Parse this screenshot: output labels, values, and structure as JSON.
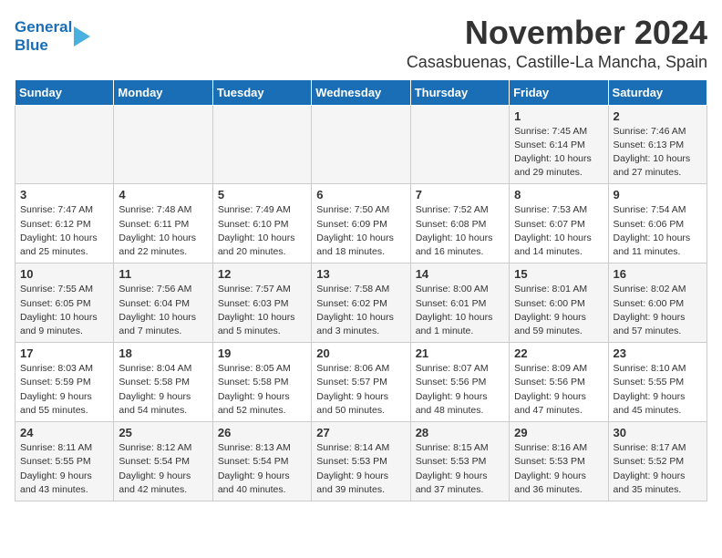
{
  "logo": {
    "line1": "General",
    "line2": "Blue"
  },
  "title": "November 2024",
  "location": "Casasbuenas, Castille-La Mancha, Spain",
  "weekdays": [
    "Sunday",
    "Monday",
    "Tuesday",
    "Wednesday",
    "Thursday",
    "Friday",
    "Saturday"
  ],
  "weeks": [
    [
      {
        "day": "",
        "info": ""
      },
      {
        "day": "",
        "info": ""
      },
      {
        "day": "",
        "info": ""
      },
      {
        "day": "",
        "info": ""
      },
      {
        "day": "",
        "info": ""
      },
      {
        "day": "1",
        "info": "Sunrise: 7:45 AM\nSunset: 6:14 PM\nDaylight: 10 hours\nand 29 minutes."
      },
      {
        "day": "2",
        "info": "Sunrise: 7:46 AM\nSunset: 6:13 PM\nDaylight: 10 hours\nand 27 minutes."
      }
    ],
    [
      {
        "day": "3",
        "info": "Sunrise: 7:47 AM\nSunset: 6:12 PM\nDaylight: 10 hours\nand 25 minutes."
      },
      {
        "day": "4",
        "info": "Sunrise: 7:48 AM\nSunset: 6:11 PM\nDaylight: 10 hours\nand 22 minutes."
      },
      {
        "day": "5",
        "info": "Sunrise: 7:49 AM\nSunset: 6:10 PM\nDaylight: 10 hours\nand 20 minutes."
      },
      {
        "day": "6",
        "info": "Sunrise: 7:50 AM\nSunset: 6:09 PM\nDaylight: 10 hours\nand 18 minutes."
      },
      {
        "day": "7",
        "info": "Sunrise: 7:52 AM\nSunset: 6:08 PM\nDaylight: 10 hours\nand 16 minutes."
      },
      {
        "day": "8",
        "info": "Sunrise: 7:53 AM\nSunset: 6:07 PM\nDaylight: 10 hours\nand 14 minutes."
      },
      {
        "day": "9",
        "info": "Sunrise: 7:54 AM\nSunset: 6:06 PM\nDaylight: 10 hours\nand 11 minutes."
      }
    ],
    [
      {
        "day": "10",
        "info": "Sunrise: 7:55 AM\nSunset: 6:05 PM\nDaylight: 10 hours\nand 9 minutes."
      },
      {
        "day": "11",
        "info": "Sunrise: 7:56 AM\nSunset: 6:04 PM\nDaylight: 10 hours\nand 7 minutes."
      },
      {
        "day": "12",
        "info": "Sunrise: 7:57 AM\nSunset: 6:03 PM\nDaylight: 10 hours\nand 5 minutes."
      },
      {
        "day": "13",
        "info": "Sunrise: 7:58 AM\nSunset: 6:02 PM\nDaylight: 10 hours\nand 3 minutes."
      },
      {
        "day": "14",
        "info": "Sunrise: 8:00 AM\nSunset: 6:01 PM\nDaylight: 10 hours\nand 1 minute."
      },
      {
        "day": "15",
        "info": "Sunrise: 8:01 AM\nSunset: 6:00 PM\nDaylight: 9 hours\nand 59 minutes."
      },
      {
        "day": "16",
        "info": "Sunrise: 8:02 AM\nSunset: 6:00 PM\nDaylight: 9 hours\nand 57 minutes."
      }
    ],
    [
      {
        "day": "17",
        "info": "Sunrise: 8:03 AM\nSunset: 5:59 PM\nDaylight: 9 hours\nand 55 minutes."
      },
      {
        "day": "18",
        "info": "Sunrise: 8:04 AM\nSunset: 5:58 PM\nDaylight: 9 hours\nand 54 minutes."
      },
      {
        "day": "19",
        "info": "Sunrise: 8:05 AM\nSunset: 5:58 PM\nDaylight: 9 hours\nand 52 minutes."
      },
      {
        "day": "20",
        "info": "Sunrise: 8:06 AM\nSunset: 5:57 PM\nDaylight: 9 hours\nand 50 minutes."
      },
      {
        "day": "21",
        "info": "Sunrise: 8:07 AM\nSunset: 5:56 PM\nDaylight: 9 hours\nand 48 minutes."
      },
      {
        "day": "22",
        "info": "Sunrise: 8:09 AM\nSunset: 5:56 PM\nDaylight: 9 hours\nand 47 minutes."
      },
      {
        "day": "23",
        "info": "Sunrise: 8:10 AM\nSunset: 5:55 PM\nDaylight: 9 hours\nand 45 minutes."
      }
    ],
    [
      {
        "day": "24",
        "info": "Sunrise: 8:11 AM\nSunset: 5:55 PM\nDaylight: 9 hours\nand 43 minutes."
      },
      {
        "day": "25",
        "info": "Sunrise: 8:12 AM\nSunset: 5:54 PM\nDaylight: 9 hours\nand 42 minutes."
      },
      {
        "day": "26",
        "info": "Sunrise: 8:13 AM\nSunset: 5:54 PM\nDaylight: 9 hours\nand 40 minutes."
      },
      {
        "day": "27",
        "info": "Sunrise: 8:14 AM\nSunset: 5:53 PM\nDaylight: 9 hours\nand 39 minutes."
      },
      {
        "day": "28",
        "info": "Sunrise: 8:15 AM\nSunset: 5:53 PM\nDaylight: 9 hours\nand 37 minutes."
      },
      {
        "day": "29",
        "info": "Sunrise: 8:16 AM\nSunset: 5:53 PM\nDaylight: 9 hours\nand 36 minutes."
      },
      {
        "day": "30",
        "info": "Sunrise: 8:17 AM\nSunset: 5:52 PM\nDaylight: 9 hours\nand 35 minutes."
      }
    ]
  ]
}
